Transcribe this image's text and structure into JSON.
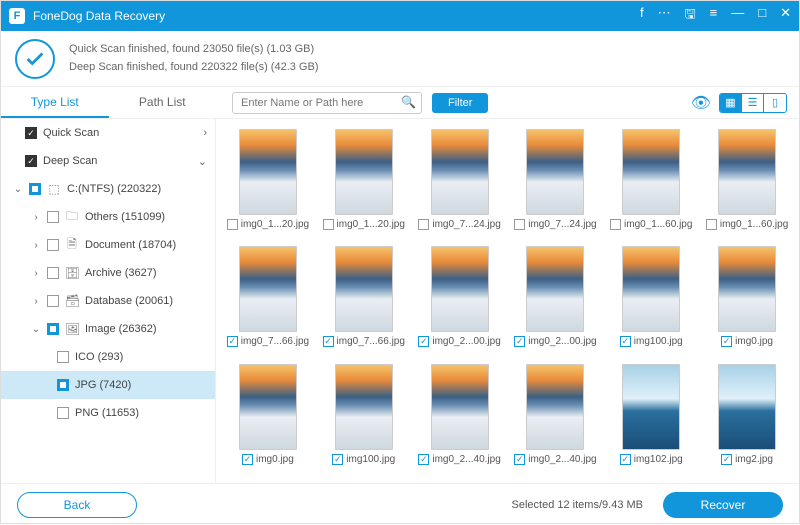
{
  "app": {
    "title": "FoneDog Data Recovery"
  },
  "status": {
    "line1": "Quick Scan finished, found 23050 file(s) (1.03 GB)",
    "line2": "Deep Scan finished, found 220322 file(s) (42.3 GB)"
  },
  "tabs": {
    "type_list": "Type List",
    "path_list": "Path List"
  },
  "search": {
    "placeholder": "Enter Name or Path here"
  },
  "buttons": {
    "filter": "Filter",
    "back": "Back",
    "recover": "Recover"
  },
  "sidebar": {
    "quick_scan": "Quick Scan",
    "deep_scan": "Deep Scan",
    "drive": "C:(NTFS) (220322)",
    "others": "Others (151099)",
    "document": "Document (18704)",
    "archive": "Archive (3627)",
    "database": "Database (20061)",
    "image": "Image (26362)",
    "ico": "ICO (293)",
    "jpg": "JPG (7420)",
    "png": "PNG (11653)"
  },
  "files": [
    {
      "name": "img0_1...20.jpg",
      "checked": false,
      "style": "a"
    },
    {
      "name": "img0_1...20.jpg",
      "checked": false,
      "style": "a"
    },
    {
      "name": "img0_7...24.jpg",
      "checked": false,
      "style": "a"
    },
    {
      "name": "img0_7...24.jpg",
      "checked": false,
      "style": "a"
    },
    {
      "name": "img0_1...60.jpg",
      "checked": false,
      "style": "a"
    },
    {
      "name": "img0_1...60.jpg",
      "checked": false,
      "style": "a"
    },
    {
      "name": "img0_7...66.jpg",
      "checked": true,
      "style": "a"
    },
    {
      "name": "img0_7...66.jpg",
      "checked": true,
      "style": "a"
    },
    {
      "name": "img0_2...00.jpg",
      "checked": true,
      "style": "a"
    },
    {
      "name": "img0_2...00.jpg",
      "checked": true,
      "style": "a"
    },
    {
      "name": "img100.jpg",
      "checked": true,
      "style": "a"
    },
    {
      "name": "img0.jpg",
      "checked": true,
      "style": "a"
    },
    {
      "name": "img0.jpg",
      "checked": true,
      "style": "a"
    },
    {
      "name": "img100.jpg",
      "checked": true,
      "style": "a"
    },
    {
      "name": "img0_2...40.jpg",
      "checked": true,
      "style": "a"
    },
    {
      "name": "img0_2...40.jpg",
      "checked": true,
      "style": "a"
    },
    {
      "name": "img102.jpg",
      "checked": true,
      "style": "b"
    },
    {
      "name": "img2.jpg",
      "checked": true,
      "style": "b"
    }
  ],
  "footer": {
    "selected": "Selected 12 items/9.43 MB"
  }
}
